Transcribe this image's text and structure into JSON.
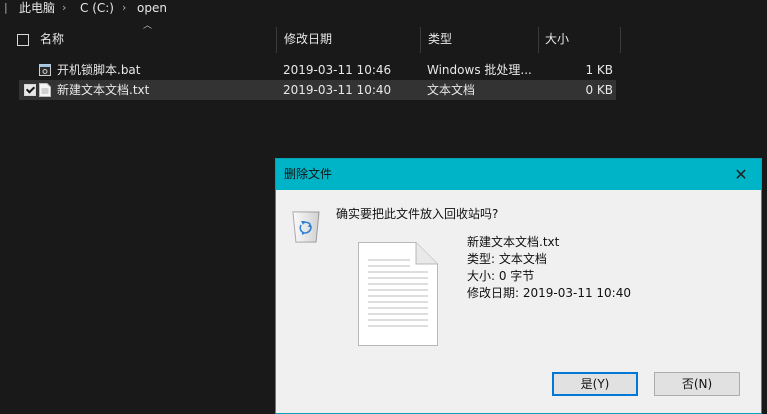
{
  "breadcrumb": {
    "items": [
      "此电脑",
      "C (C:)",
      "open"
    ]
  },
  "columns": {
    "name": "名称",
    "modified": "修改日期",
    "type": "类型",
    "size": "大小"
  },
  "files": [
    {
      "name": "开机锁脚本.bat",
      "modified": "2019-03-11 10:46",
      "type": "Windows 批处理...",
      "size": "1 KB",
      "icon": "bat-file-icon",
      "checked": false,
      "selected": false
    },
    {
      "name": "新建文本文档.txt",
      "modified": "2019-03-11 10:40",
      "type": "文本文档",
      "size": "0 KB",
      "icon": "text-file-icon",
      "checked": true,
      "selected": true
    }
  ],
  "dialog": {
    "title": "删除文件",
    "question": "确实要把此文件放入回收站吗?",
    "file_name": "新建文本文档.txt",
    "file_type": "类型: 文本文档",
    "file_size": "大小: 0 字节",
    "file_modified": "修改日期: 2019-03-11 10:40",
    "yes_label": "是(Y)",
    "no_label": "否(N)"
  },
  "colors": {
    "background": "#191919",
    "titlebar": "#00b4c8",
    "dialog": "#f0f0f0",
    "accent": "#0078d7"
  }
}
